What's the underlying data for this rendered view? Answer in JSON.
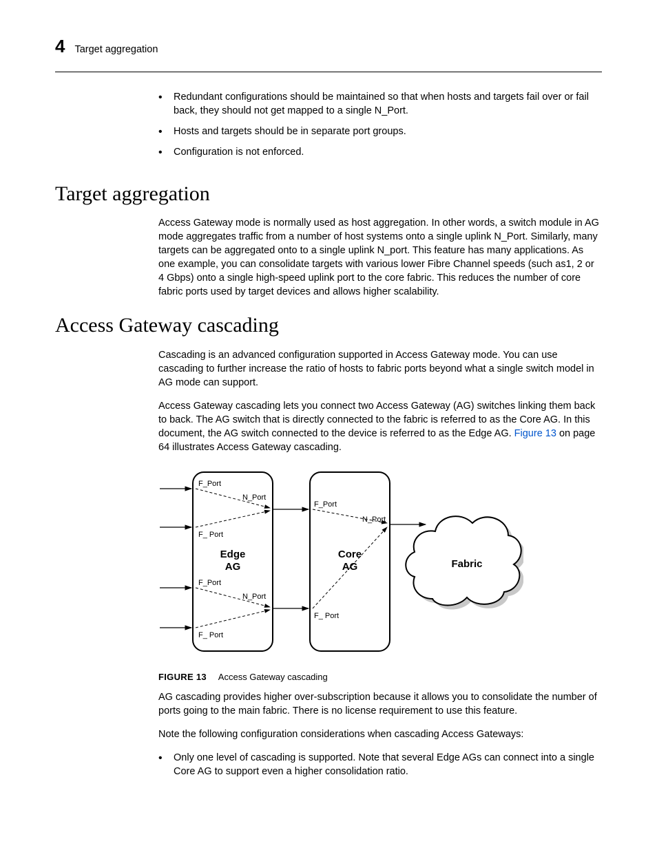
{
  "header": {
    "chapter_number": "4",
    "chapter_title": "Target aggregation"
  },
  "bullets_top": [
    "Redundant configurations should be maintained so that when hosts and targets fail over or fail back, they should not get mapped to a single N_Port.",
    "Hosts and targets should be in separate port groups.",
    "Configuration is not enforced."
  ],
  "section1": {
    "title": "Target aggregation",
    "para": "Access Gateway mode is normally used as host aggregation. In other words, a switch module in AG mode aggregates traffic from a number of host systems onto a single uplink N_Port. Similarly, many targets can be aggregated onto to a single uplink N_port. This feature has many applications. As one example, you can consolidate targets with various lower Fibre Channel speeds (such as1, 2 or 4 Gbps) onto a single high-speed uplink port to the core fabric. This reduces the number of core fabric ports used by target devices and allows higher scalability."
  },
  "section2": {
    "title": "Access Gateway cascading",
    "para1": "Cascading is an advanced configuration supported in Access Gateway mode. You can use cascading to further increase the ratio of hosts to fabric ports beyond what a single switch model in AG mode can support.",
    "para2_a": "Access Gateway cascading lets you connect two Access Gateway (AG) switches linking them back to back. The AG switch that is directly connected to the fabric is referred to as the Core AG. In this document, the AG switch connected to the device is referred to as the Edge AG. ",
    "para2_link": "Figure 13",
    "para2_b": " on page 64 illustrates Access Gateway cascading.",
    "figure": {
      "label": "FIGURE 13",
      "caption": "Access Gateway cascading",
      "labels": {
        "edge": "Edge\nAG",
        "core": "Core\nAG",
        "fabric": "Fabric",
        "f_port": "F_Port",
        "f_port_sp": "F_ Port",
        "n_port": "N_Port"
      }
    },
    "para3": "AG cascading provides higher over-subscription because it allows you to consolidate the number of ports going to the main fabric. There is no license requirement to use this feature.",
    "para4": "Note the following configuration considerations when cascading Access Gateways:",
    "bullets": [
      "Only one level of cascading is supported. Note that several Edge AGs can connect into a single Core AG to support even a higher consolidation ratio."
    ]
  }
}
